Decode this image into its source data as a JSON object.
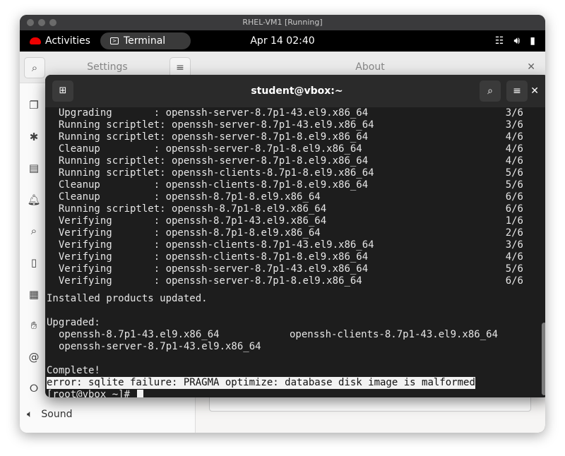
{
  "vm": {
    "title": "RHEL-VM1 [Running]"
  },
  "topbar": {
    "activities": "Activities",
    "app": "Terminal",
    "clock": "Apr 14  02:40"
  },
  "settings": {
    "sidebar_title": "Settings",
    "main_title": "About",
    "sound_label": "Sound"
  },
  "terminal": {
    "title": "student@vbox:~",
    "transactions": [
      {
        "action": "Upgrading       ",
        "pkg": "openssh-server-8.7p1-43.el9.x86_64",
        "count": "3/6"
      },
      {
        "action": "Running scriptlet",
        "pkg": "openssh-server-8.7p1-43.el9.x86_64",
        "count": "3/6"
      },
      {
        "action": "Running scriptlet",
        "pkg": "openssh-server-8.7p1-8.el9.x86_64",
        "count": "4/6"
      },
      {
        "action": "Cleanup         ",
        "pkg": "openssh-server-8.7p1-8.el9.x86_64",
        "count": "4/6"
      },
      {
        "action": "Running scriptlet",
        "pkg": "openssh-server-8.7p1-8.el9.x86_64",
        "count": "4/6"
      },
      {
        "action": "Running scriptlet",
        "pkg": "openssh-clients-8.7p1-8.el9.x86_64",
        "count": "5/6"
      },
      {
        "action": "Cleanup         ",
        "pkg": "openssh-clients-8.7p1-8.el9.x86_64",
        "count": "5/6"
      },
      {
        "action": "Cleanup         ",
        "pkg": "openssh-8.7p1-8.el9.x86_64",
        "count": "6/6"
      },
      {
        "action": "Running scriptlet",
        "pkg": "openssh-8.7p1-8.el9.x86_64",
        "count": "6/6"
      },
      {
        "action": "Verifying       ",
        "pkg": "openssh-8.7p1-43.el9.x86_64",
        "count": "1/6"
      },
      {
        "action": "Verifying       ",
        "pkg": "openssh-8.7p1-8.el9.x86_64",
        "count": "2/6"
      },
      {
        "action": "Verifying       ",
        "pkg": "openssh-clients-8.7p1-43.el9.x86_64",
        "count": "3/6"
      },
      {
        "action": "Verifying       ",
        "pkg": "openssh-clients-8.7p1-8.el9.x86_64",
        "count": "4/6"
      },
      {
        "action": "Verifying       ",
        "pkg": "openssh-server-8.7p1-43.el9.x86_64",
        "count": "5/6"
      },
      {
        "action": "Verifying       ",
        "pkg": "openssh-server-8.7p1-8.el9.x86_64",
        "count": "6/6"
      }
    ],
    "installed_msg": "Installed products updated.",
    "upgraded_header": "Upgraded:",
    "upgraded": [
      "openssh-8.7p1-43.el9.x86_64",
      "openssh-clients-8.7p1-43.el9.x86_64",
      "openssh-server-8.7p1-43.el9.x86_64"
    ],
    "complete": "Complete!",
    "error": "error: sqlite failure: PRAGMA optimize: database disk image is malformed",
    "prompt": "[root@vbox ~]# "
  }
}
